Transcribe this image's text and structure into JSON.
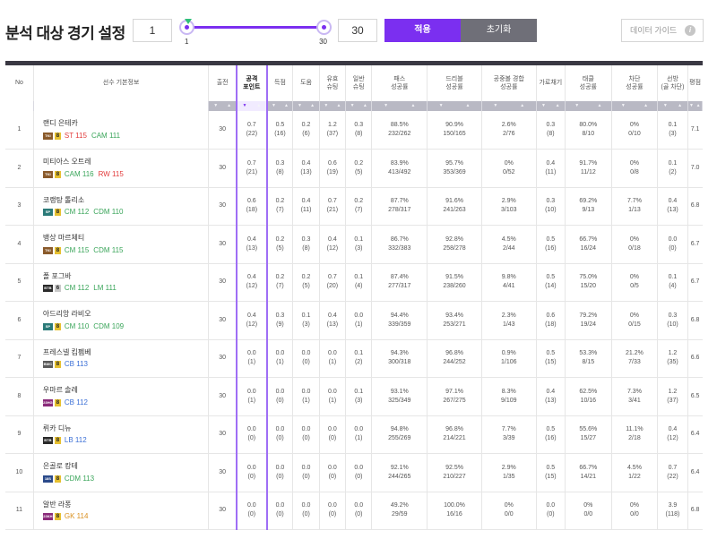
{
  "header": {
    "title": "분석 대상 경기 설정",
    "min_value": "1",
    "max_value": "30",
    "slider_min_label": "1",
    "slider_max_label": "30",
    "slider_range_min": 1,
    "slider_range_max": 30,
    "apply_label": "적용",
    "reset_label": "초기화",
    "guide_label": "데이터 가이드",
    "guide_icon": "info-icon",
    "accent_color": "#7b2ff0"
  },
  "table": {
    "columns": [
      {
        "key": "no",
        "label": [
          "No"
        ]
      },
      {
        "key": "player",
        "label": [
          "선수 기본정보"
        ]
      },
      {
        "key": "apps",
        "label": [
          "출전"
        ]
      },
      {
        "key": "attack_pts",
        "label": [
          "공격",
          "포인트"
        ],
        "selected": true
      },
      {
        "key": "goals",
        "label": [
          "득점"
        ]
      },
      {
        "key": "assists",
        "label": [
          "도움"
        ]
      },
      {
        "key": "shots_on",
        "label": [
          "유효",
          "슈팅"
        ]
      },
      {
        "key": "shots",
        "label": [
          "일반",
          "슈팅"
        ]
      },
      {
        "key": "pass",
        "label": [
          "패스",
          "성공률"
        ]
      },
      {
        "key": "dribble",
        "label": [
          "드리블",
          "성공률"
        ]
      },
      {
        "key": "aerial",
        "label": [
          "공중볼 경합",
          "성공률"
        ]
      },
      {
        "key": "intercept",
        "label": [
          "가로채기"
        ]
      },
      {
        "key": "tackle",
        "label": [
          "태클",
          "성공률"
        ]
      },
      {
        "key": "block",
        "label": [
          "차단",
          "성공률"
        ]
      },
      {
        "key": "defense",
        "label": [
          "선방",
          "(골 차단)"
        ]
      },
      {
        "key": "rating",
        "label": [
          "평점"
        ]
      }
    ],
    "rows": [
      {
        "no": "1",
        "name": "랜디 은테카",
        "season": "TKI",
        "season_color": "#8a5a2b",
        "grade": "8",
        "grade_type": "gold",
        "positions": [
          {
            "pos": "ST",
            "ovr": "115",
            "cls": "st"
          },
          {
            "pos": "CAM",
            "ovr": "111",
            "cls": "cam"
          }
        ],
        "apps": "30",
        "attack_pts": [
          "0.7",
          "(22)"
        ],
        "goals": [
          "0.5",
          "(16)"
        ],
        "assists": [
          "0.2",
          "(6)"
        ],
        "shots_on": [
          "1.2",
          "(37)"
        ],
        "shots": [
          "0.3",
          "(8)"
        ],
        "pass": [
          "88.5%",
          "232/262"
        ],
        "dribble": [
          "90.9%",
          "150/165"
        ],
        "aerial": [
          "2.6%",
          "2/76"
        ],
        "intercept": [
          "0.3",
          "(8)"
        ],
        "tackle": [
          "80.0%",
          "8/10"
        ],
        "block": [
          "0%",
          "0/10"
        ],
        "defense": [
          "0.1",
          "(3)"
        ],
        "rating": "7.1"
      },
      {
        "no": "2",
        "name": "미티아스 오트레",
        "season": "TKI",
        "season_color": "#8a5a2b",
        "grade": "8",
        "grade_type": "gold",
        "positions": [
          {
            "pos": "CAM",
            "ovr": "116",
            "cls": "cam"
          },
          {
            "pos": "RW",
            "ovr": "115",
            "cls": "rw"
          }
        ],
        "apps": "30",
        "attack_pts": [
          "0.7",
          "(21)"
        ],
        "goals": [
          "0.3",
          "(8)"
        ],
        "assists": [
          "0.4",
          "(13)"
        ],
        "shots_on": [
          "0.6",
          "(19)"
        ],
        "shots": [
          "0.2",
          "(5)"
        ],
        "pass": [
          "83.9%",
          "413/492"
        ],
        "dribble": [
          "95.7%",
          "353/369"
        ],
        "aerial": [
          "0%",
          "0/52"
        ],
        "intercept": [
          "0.4",
          "(11)"
        ],
        "tackle": [
          "91.7%",
          "11/12"
        ],
        "block": [
          "0%",
          "0/8"
        ],
        "defense": [
          "0.1",
          "(2)"
        ],
        "rating": "7.0"
      },
      {
        "no": "3",
        "name": "코랭탕 톨리소",
        "season": "SP",
        "season_color": "#2b7a78",
        "grade": "8",
        "grade_type": "gold",
        "positions": [
          {
            "pos": "CM",
            "ovr": "112",
            "cls": "cm"
          },
          {
            "pos": "CDM",
            "ovr": "110",
            "cls": "cdm"
          }
        ],
        "apps": "30",
        "attack_pts": [
          "0.6",
          "(18)"
        ],
        "goals": [
          "0.2",
          "(7)"
        ],
        "assists": [
          "0.4",
          "(11)"
        ],
        "shots_on": [
          "0.7",
          "(21)"
        ],
        "shots": [
          "0.2",
          "(7)"
        ],
        "pass": [
          "87.7%",
          "278/317"
        ],
        "dribble": [
          "91.6%",
          "241/263"
        ],
        "aerial": [
          "2.9%",
          "3/103"
        ],
        "intercept": [
          "0.3",
          "(10)"
        ],
        "tackle": [
          "69.2%",
          "9/13"
        ],
        "block": [
          "7.7%",
          "1/13"
        ],
        "defense": [
          "0.4",
          "(13)"
        ],
        "rating": "6.8"
      },
      {
        "no": "4",
        "name": "뱅상 마르체티",
        "season": "TKI",
        "season_color": "#8a5a2b",
        "grade": "8",
        "grade_type": "gold",
        "positions": [
          {
            "pos": "CM",
            "ovr": "115",
            "cls": "cm"
          },
          {
            "pos": "CDM",
            "ovr": "115",
            "cls": "cdm"
          }
        ],
        "apps": "30",
        "attack_pts": [
          "0.4",
          "(13)"
        ],
        "goals": [
          "0.2",
          "(5)"
        ],
        "assists": [
          "0.3",
          "(8)"
        ],
        "shots_on": [
          "0.4",
          "(12)"
        ],
        "shots": [
          "0.1",
          "(3)"
        ],
        "pass": [
          "86.7%",
          "332/383"
        ],
        "dribble": [
          "92.8%",
          "258/278"
        ],
        "aerial": [
          "4.5%",
          "2/44"
        ],
        "intercept": [
          "0.5",
          "(16)"
        ],
        "tackle": [
          "66.7%",
          "16/24"
        ],
        "block": [
          "0%",
          "0/18"
        ],
        "defense": [
          "0.0",
          "(0)"
        ],
        "rating": "6.7"
      },
      {
        "no": "5",
        "name": "폴 포그바",
        "season": "BTB",
        "season_color": "#2b2b2b",
        "grade": "6",
        "grade_type": "silver",
        "positions": [
          {
            "pos": "CM",
            "ovr": "112",
            "cls": "cm"
          },
          {
            "pos": "LM",
            "ovr": "111",
            "cls": "lm"
          }
        ],
        "apps": "30",
        "attack_pts": [
          "0.4",
          "(12)"
        ],
        "goals": [
          "0.2",
          "(7)"
        ],
        "assists": [
          "0.2",
          "(5)"
        ],
        "shots_on": [
          "0.7",
          "(20)"
        ],
        "shots": [
          "0.1",
          "(4)"
        ],
        "pass": [
          "87.4%",
          "277/317"
        ],
        "dribble": [
          "91.5%",
          "238/260"
        ],
        "aerial": [
          "9.8%",
          "4/41"
        ],
        "intercept": [
          "0.5",
          "(14)"
        ],
        "tackle": [
          "75.0%",
          "15/20"
        ],
        "block": [
          "0%",
          "0/5"
        ],
        "defense": [
          "0.1",
          "(4)"
        ],
        "rating": "6.7"
      },
      {
        "no": "6",
        "name": "아드리앙 라비오",
        "season": "SP",
        "season_color": "#2b7a78",
        "grade": "8",
        "grade_type": "gold",
        "positions": [
          {
            "pos": "CM",
            "ovr": "110",
            "cls": "cm"
          },
          {
            "pos": "CDM",
            "ovr": "109",
            "cls": "cdm"
          }
        ],
        "apps": "30",
        "attack_pts": [
          "0.4",
          "(12)"
        ],
        "goals": [
          "0.3",
          "(9)"
        ],
        "assists": [
          "0.1",
          "(3)"
        ],
        "shots_on": [
          "0.4",
          "(13)"
        ],
        "shots": [
          "0.0",
          "(1)"
        ],
        "pass": [
          "94.4%",
          "339/359"
        ],
        "dribble": [
          "93.4%",
          "253/271"
        ],
        "aerial": [
          "2.3%",
          "1/43"
        ],
        "intercept": [
          "0.6",
          "(18)"
        ],
        "tackle": [
          "79.2%",
          "19/24"
        ],
        "block": [
          "0%",
          "0/15"
        ],
        "defense": [
          "0.3",
          "(10)"
        ],
        "rating": "6.8"
      },
      {
        "no": "7",
        "name": "프레스넬 킴펨베",
        "season": "BWC",
        "season_color": "#5b5b5b",
        "grade": "8",
        "grade_type": "gold",
        "positions": [
          {
            "pos": "CB",
            "ovr": "113",
            "cls": "cb"
          }
        ],
        "apps": "30",
        "attack_pts": [
          "0.0",
          "(1)"
        ],
        "goals": [
          "0.0",
          "(1)"
        ],
        "assists": [
          "0.0",
          "(0)"
        ],
        "shots_on": [
          "0.0",
          "(1)"
        ],
        "shots": [
          "0.1",
          "(2)"
        ],
        "pass": [
          "94.3%",
          "300/318"
        ],
        "dribble": [
          "96.8%",
          "244/252"
        ],
        "aerial": [
          "0.9%",
          "1/106"
        ],
        "intercept": [
          "0.5",
          "(15)"
        ],
        "tackle": [
          "53.3%",
          "8/15"
        ],
        "block": [
          "21.2%",
          "7/33"
        ],
        "defense": [
          "1.2",
          "(35)"
        ],
        "rating": "6.6"
      },
      {
        "no": "8",
        "name": "우마르 솔레",
        "season": "23HG",
        "season_color": "#8a2b7a",
        "grade": "8",
        "grade_type": "gold",
        "positions": [
          {
            "pos": "CB",
            "ovr": "112",
            "cls": "cb"
          }
        ],
        "apps": "30",
        "attack_pts": [
          "0.0",
          "(1)"
        ],
        "goals": [
          "0.0",
          "(0)"
        ],
        "assists": [
          "0.0",
          "(1)"
        ],
        "shots_on": [
          "0.0",
          "(1)"
        ],
        "shots": [
          "0.1",
          "(3)"
        ],
        "pass": [
          "93.1%",
          "325/349"
        ],
        "dribble": [
          "97.1%",
          "267/275"
        ],
        "aerial": [
          "8.3%",
          "9/109"
        ],
        "intercept": [
          "0.4",
          "(13)"
        ],
        "tackle": [
          "62.5%",
          "10/16"
        ],
        "block": [
          "7.3%",
          "3/41"
        ],
        "defense": [
          "1.2",
          "(37)"
        ],
        "rating": "6.5"
      },
      {
        "no": "9",
        "name": "뤼카 디뉴",
        "season": "BTB",
        "season_color": "#2b2b2b",
        "grade": "8",
        "grade_type": "gold",
        "positions": [
          {
            "pos": "LB",
            "ovr": "112",
            "cls": "lb"
          }
        ],
        "apps": "30",
        "attack_pts": [
          "0.0",
          "(0)"
        ],
        "goals": [
          "0.0",
          "(0)"
        ],
        "assists": [
          "0.0",
          "(0)"
        ],
        "shots_on": [
          "0.0",
          "(0)"
        ],
        "shots": [
          "0.0",
          "(1)"
        ],
        "pass": [
          "94.8%",
          "255/269"
        ],
        "dribble": [
          "96.8%",
          "214/221"
        ],
        "aerial": [
          "7.7%",
          "3/39"
        ],
        "intercept": [
          "0.5",
          "(16)"
        ],
        "tackle": [
          "55.6%",
          "15/27"
        ],
        "block": [
          "11.1%",
          "2/18"
        ],
        "defense": [
          "0.4",
          "(12)"
        ],
        "rating": "6.4"
      },
      {
        "no": "10",
        "name": "은골로 캉테",
        "season": "18S",
        "season_color": "#2b4a8a",
        "grade": "8",
        "grade_type": "gold",
        "positions": [
          {
            "pos": "CDM",
            "ovr": "113",
            "cls": "cdm"
          }
        ],
        "apps": "30",
        "attack_pts": [
          "0.0",
          "(0)"
        ],
        "goals": [
          "0.0",
          "(0)"
        ],
        "assists": [
          "0.0",
          "(0)"
        ],
        "shots_on": [
          "0.0",
          "(0)"
        ],
        "shots": [
          "0.0",
          "(0)"
        ],
        "pass": [
          "92.1%",
          "244/265"
        ],
        "dribble": [
          "92.5%",
          "210/227"
        ],
        "aerial": [
          "2.9%",
          "1/35"
        ],
        "intercept": [
          "0.5",
          "(15)"
        ],
        "tackle": [
          "66.7%",
          "14/21"
        ],
        "block": [
          "4.5%",
          "1/22"
        ],
        "defense": [
          "0.7",
          "(22)"
        ],
        "rating": "6.4"
      },
      {
        "no": "11",
        "name": "알반 라퐁",
        "season": "23KH",
        "season_color": "#8a2b7a",
        "grade": "8",
        "grade_type": "gold",
        "positions": [
          {
            "pos": "GK",
            "ovr": "114",
            "cls": "gk"
          }
        ],
        "apps": "30",
        "attack_pts": [
          "0.0",
          "(0)"
        ],
        "goals": [
          "0.0",
          "(0)"
        ],
        "assists": [
          "0.0",
          "(0)"
        ],
        "shots_on": [
          "0.0",
          "(0)"
        ],
        "shots": [
          "0.0",
          "(0)"
        ],
        "pass": [
          "49.2%",
          "29/59"
        ],
        "dribble": [
          "100.0%",
          "16/16"
        ],
        "aerial": [
          "0%",
          "0/0"
        ],
        "intercept": [
          "0.0",
          "(0)"
        ],
        "tackle": [
          "0%",
          "0/0"
        ],
        "block": [
          "0%",
          "0/0"
        ],
        "defense": [
          "3.9",
          "(118)"
        ],
        "rating": "6.8"
      }
    ]
  }
}
